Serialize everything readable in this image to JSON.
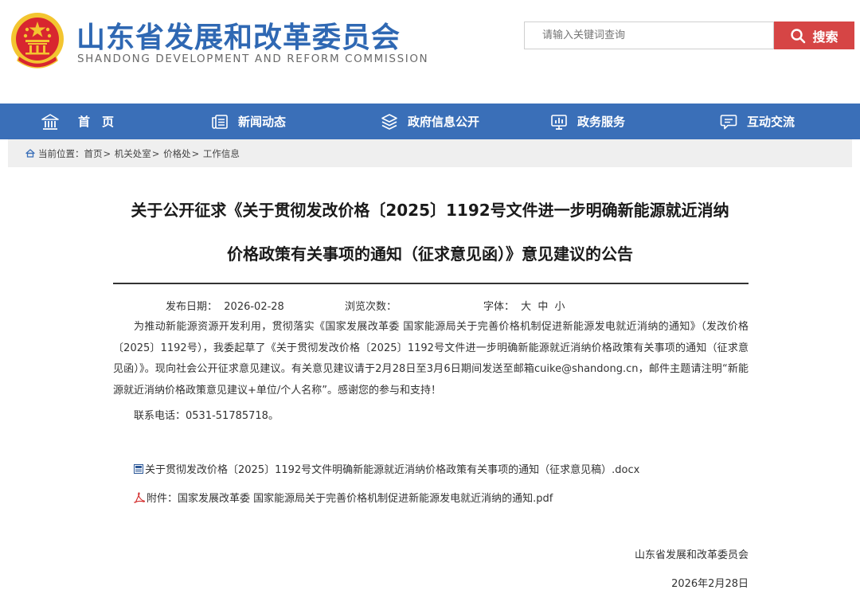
{
  "header": {
    "site_title": "山东省发展和改革委员会",
    "site_subtitle": "SHANDONG DEVELOPMENT AND REFORM COMMISSION",
    "search_placeholder": "请输入关键词查询",
    "search_button": "搜索"
  },
  "nav": {
    "items": [
      {
        "label": "首　页",
        "icon": "home-icon"
      },
      {
        "label": "新闻动态",
        "icon": "news-icon"
      },
      {
        "label": "政府信息公开",
        "icon": "layers-icon"
      },
      {
        "label": "政务服务",
        "icon": "service-chart-icon"
      },
      {
        "label": "互动交流",
        "icon": "chat-icon"
      }
    ]
  },
  "breadcrumb": {
    "prefix": "当前位置：",
    "items": [
      "首页",
      "机关处室",
      "价格处",
      "工作信息"
    ],
    "separator": ">"
  },
  "article": {
    "title_line1": "关于公开征求《关于贯彻发改价格〔2025〕1192号文件进一步明确新能源就近消纳",
    "title_line2": "价格政策有关事项的通知（征求意见函）》意见建议的公告",
    "publish_label": "发布日期：",
    "publish_date": "2026-02-28",
    "views_label": "浏览次数：",
    "font_label": "字体：",
    "font_large": "大",
    "font_medium": "中",
    "font_small": "小",
    "body": "为推动新能源资源开发利用，贯彻落实《国家发展改革委 国家能源局关于完善价格机制促进新能源发电就近消纳的通知》（发改价格〔2025〕1192号），我委起草了《关于贯彻发改价格〔2025〕1192号文件进一步明确新能源就近消纳价格政策有关事项的通知（征求意见函）》。现向社会公开征求意见建议。有关意见建议请于2月28日至3月6日期间发送至邮箱cuike@shandong.cn，邮件主题请注明“新能源就近消纳价格政策意见建议+单位/个人名称”。感谢您的参与和支持！",
    "phone": "联系电话：0531-51785718。",
    "attachment_docx": "关于贯彻发改价格〔2025〕1192号文件明确新能源就近消纳价格政策有关事项的通知（征求意见稿）.docx",
    "attachment_pdf": "附件：国家发展改革委 国家能源局关于完善价格机制促进新能源发电就近消纳的通知.pdf",
    "signature_org": "山东省发展和改革委员会",
    "signature_date": "2026年2月28日"
  },
  "colors": {
    "brand_blue": "#3a6fb8",
    "title_blue": "#2f68b3",
    "search_red": "#d64545",
    "emblem_red": "#d8262f",
    "emblem_gold": "#f3c530"
  }
}
